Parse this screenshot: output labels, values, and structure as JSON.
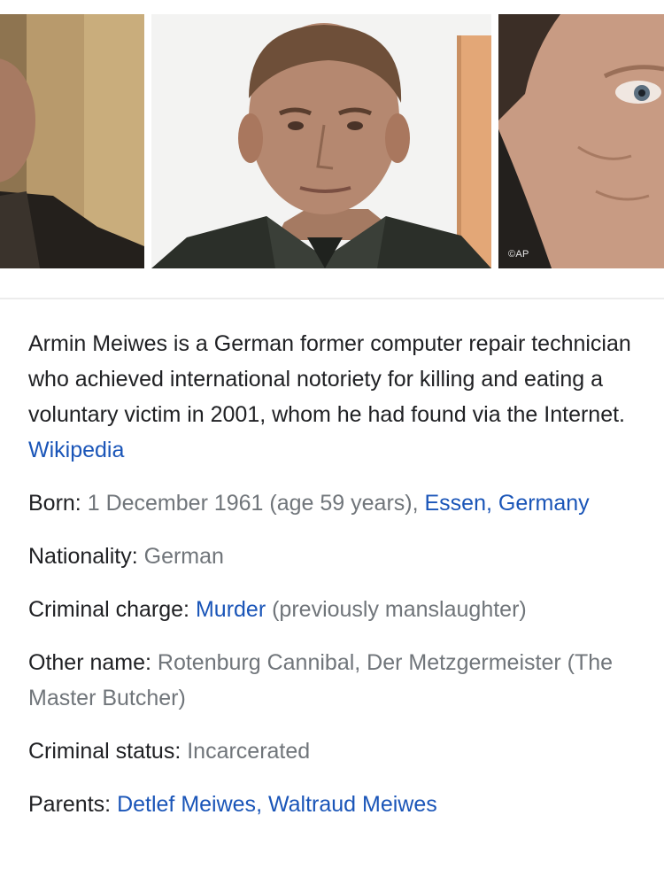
{
  "images": {
    "watermark": "©AP"
  },
  "description": {
    "text": "Armin Meiwes is a German former computer repair technician who achieved international notoriety for killing and eating a voluntary victim in 2001, whom he had found via the Internet.",
    "source_link": "Wikipedia"
  },
  "facts": {
    "born": {
      "label": "Born:",
      "date": "1 December 1961 (age 59 years),",
      "place": "Essen, Germany"
    },
    "nationality": {
      "label": "Nationality:",
      "value": "German"
    },
    "criminal_charge": {
      "label": "Criminal charge:",
      "link": "Murder",
      "note": "(previously manslaughter)"
    },
    "other_name": {
      "label": "Other name:",
      "value": "Rotenburg Cannibal, Der Metzgermeister (The Master Butcher)"
    },
    "criminal_status": {
      "label": "Criminal status:",
      "value": "Incarcerated"
    },
    "parents": {
      "label": "Parents:",
      "parent1": "Detlef Meiwes",
      "separator": ",",
      "parent2": "Waltraud Meiwes"
    }
  },
  "colors": {
    "link": "#1a55b8",
    "value_gray": "#70757a",
    "text": "#202124"
  }
}
